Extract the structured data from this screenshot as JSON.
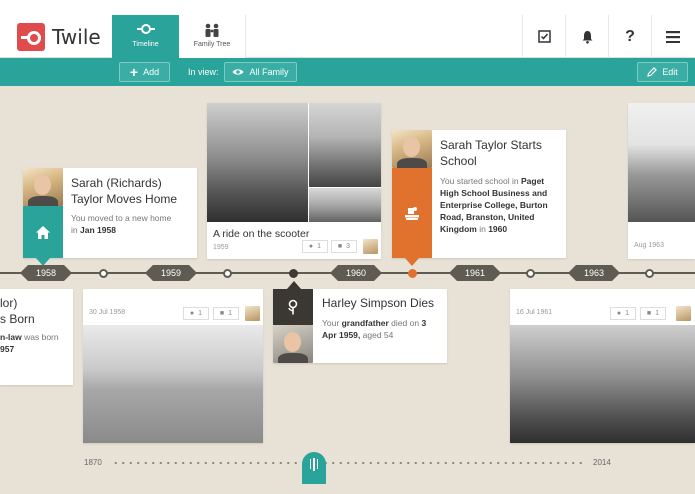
{
  "app": {
    "name": "Twile"
  },
  "nav": {
    "tabs": [
      {
        "label": "Timeline",
        "icon": "timeline-icon",
        "active": true
      },
      {
        "label": "Family Tree",
        "icon": "family-icon",
        "active": false
      }
    ],
    "icons": [
      "checkbox-icon",
      "bell-icon",
      "help-icon",
      "menu-icon"
    ]
  },
  "toolbar": {
    "add_label": "Add",
    "in_view_label": "In view:",
    "view_label": "All Family",
    "edit_label": "Edit"
  },
  "timeline": {
    "years": [
      "1958",
      "1959",
      "1960",
      "1961",
      "1963"
    ],
    "events": [
      {
        "title_line1": "Sarah (Richards)",
        "title_line2": "Taylor Moves Home",
        "text_pre": "You moved to a new home",
        "text_in": "in",
        "date": "Jan 1958"
      },
      {
        "caption": "A ride on the scooter",
        "year": "1959",
        "people": "1",
        "photos": "3"
      },
      {
        "title_line1": "Sarah Taylor Starts",
        "title_line2": "School",
        "text_1": "You started school in",
        "text_2": "Paget",
        "text_3": "High School Business and",
        "text_4": "Enterprise College, Burton",
        "text_5": "Road, Branston, United",
        "text_6": "Kingdom",
        "text_7": "in",
        "date": "1960"
      },
      {
        "year": "Aug 1963"
      },
      {
        "title_line1": "lor)",
        "title_line2": "s Born",
        "text_1": "n-law",
        "text_2": "was born",
        "text_3": "957"
      },
      {
        "date": "30 Jul 1958",
        "people": "1",
        "photos": "1"
      },
      {
        "title": "Harley Simpson Dies",
        "text_1": "Your",
        "text_2": "grandfather",
        "text_3": "died on",
        "text_4": "3",
        "text_5": "Apr 1959,",
        "text_6": "aged 54"
      },
      {
        "date": "16 Jul 1961",
        "people": "1",
        "photos": "1"
      }
    ]
  },
  "scrubber": {
    "start": "1870",
    "end": "2014"
  },
  "colors": {
    "teal": "#2aa39a",
    "orange": "#e0722d",
    "dark": "#3b3834",
    "background": "#e8e2d6",
    "logo_red": "#e04b4b"
  }
}
